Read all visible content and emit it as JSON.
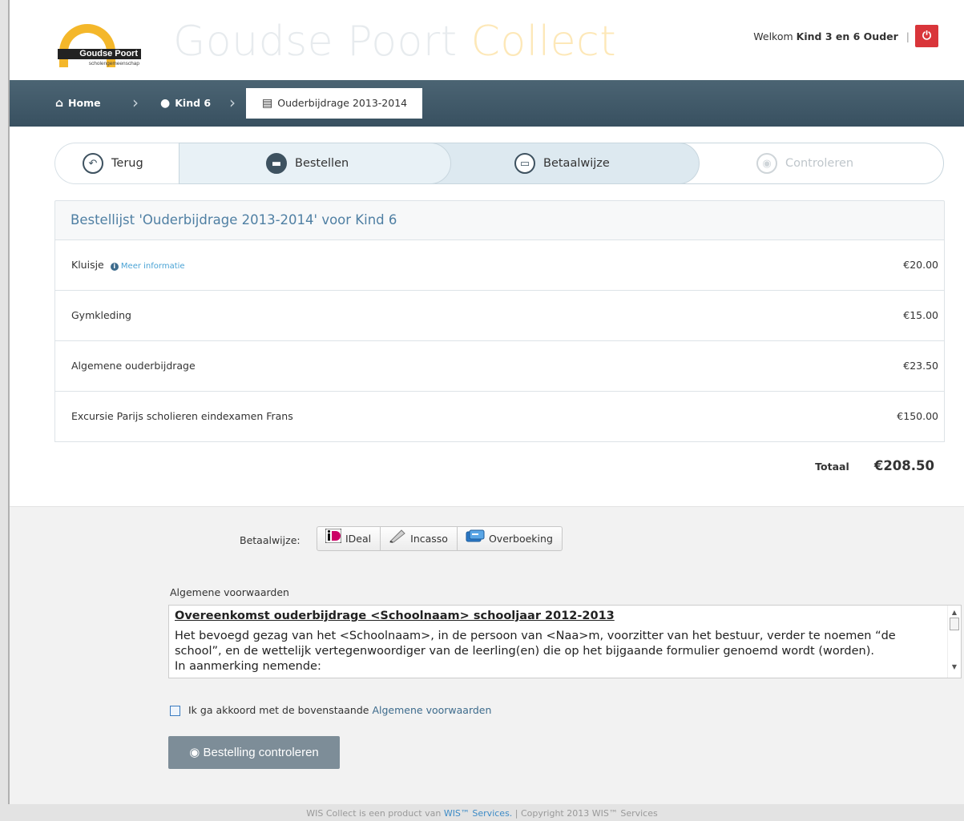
{
  "header": {
    "logo_text": "Goudse Poort",
    "logo_subtext": "scholengemeenschap",
    "brand_part1": "Goudse Poort",
    "brand_part2": "Collect",
    "welcome_prefix": "Welkom",
    "welcome_user": "Kind 3 en 6 Ouder",
    "welcome_separator": "|"
  },
  "breadcrumb": {
    "home": "Home",
    "child": "Kind 6",
    "current": "Ouderbijdrage 2013-2014"
  },
  "wizard": {
    "back": "Terug",
    "steps": [
      "Bestellen",
      "Betaalwijze",
      "Controleren"
    ]
  },
  "order": {
    "title": "Bestellijst 'Ouderbijdrage 2013-2014' voor Kind 6",
    "items": [
      {
        "name": "Kluisje",
        "more": "Meer informatie",
        "price": "€20.00"
      },
      {
        "name": "Gymkleding",
        "price": "€15.00"
      },
      {
        "name": "Algemene ouderbijdrage",
        "price": "€23.50"
      },
      {
        "name": "Excursie Parijs scholieren eindexamen Frans",
        "price": "€150.00"
      }
    ],
    "total_label": "Totaal",
    "total_value": "€208.50"
  },
  "payment": {
    "label": "Betaalwijze:",
    "options": [
      "IDeal",
      "Incasso",
      "Overboeking"
    ]
  },
  "terms": {
    "label": "Algemene voorwaarden",
    "title": "Overeenkomst ouderbijdrage <Schoolnaam> schooljaar 2012-2013",
    "body": "Het bevoegd gezag van het <Schoolnaam>, in de persoon van <Naa>m, voorzitter van het bestuur,  verder te noemen “de school”, en de wettelijk vertegenwoordiger van de leerling(en) die op het bijgaande formulier genoemd wordt (worden).",
    "body_cut": "In aanmerking nemende:",
    "agree_text": "Ik ga akkoord met de bovenstaande",
    "agree_link": "Algemene voorwaarden"
  },
  "submit_label": "Bestelling controleren",
  "footer": {
    "prefix": "WIS Collect is een product van",
    "link": "WIS™ Services.",
    "suffix": "| Copyright 2013 WIS™ Services"
  },
  "colors": {
    "navbar": "#3f5766",
    "brand_light": "#e7ebee",
    "brand_accent": "#fde8b8",
    "power": "#d9353a",
    "link": "#4f7fa3",
    "submit": "#7d8d98"
  }
}
